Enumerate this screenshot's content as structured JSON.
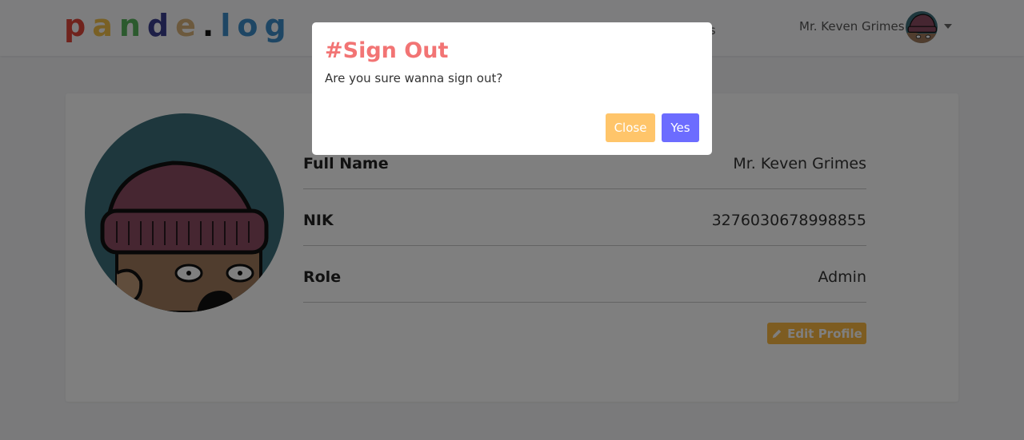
{
  "navbar": {
    "logo_letters": [
      "p",
      "a",
      "n",
      "d",
      "e",
      ".",
      "l",
      "o",
      "g"
    ],
    "logo_colors": [
      "#e0473b",
      "#f2c14a",
      "#58b45d",
      "#3b3f8f",
      "#d9b37a",
      "#111111",
      "#3c8cc8",
      "#3c8cc8",
      "#3c8cc8"
    ],
    "nav_link": "ogs",
    "user_name": "Mr. Keven Grimes",
    "avatar_icon": "user-avatar-beanie-icon"
  },
  "profile": {
    "avatar_icon": "user-avatar-beanie-icon",
    "rows": [
      {
        "label": "Full Name",
        "value": "Mr. Keven Grimes"
      },
      {
        "label": "NIK",
        "value": "3276030678998855"
      },
      {
        "label": "Role",
        "value": "Admin"
      }
    ],
    "edit_label": "Edit Profile",
    "edit_icon": "pencil-icon"
  },
  "modal": {
    "title": "#Sign Out",
    "body": "Are you sure wanna sign out?",
    "close_label": "Close",
    "yes_label": "Yes"
  },
  "colors": {
    "accent_title": "#f27474",
    "close_button": "#ffc56a",
    "yes_button": "#6c6cff",
    "edit_button": "#fbb843"
  }
}
